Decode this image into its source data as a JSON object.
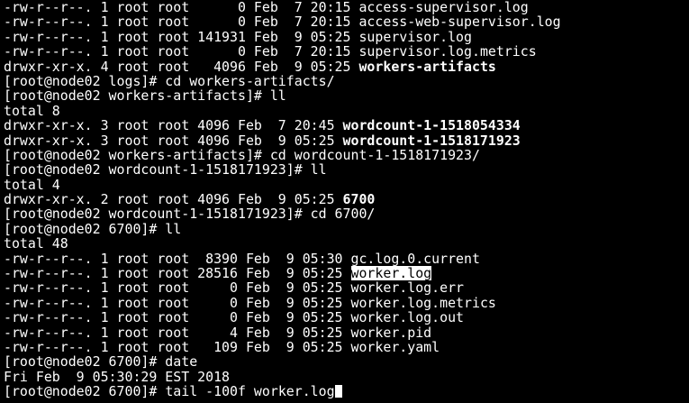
{
  "terminal": {
    "lines": [
      {
        "prefix": "-rw-r--r--. 1 root root      0 Feb  7 20:15 ",
        "name": "access-supervisor.log",
        "style": "normal"
      },
      {
        "prefix": "-rw-r--r--. 1 root root      0 Feb  7 20:15 ",
        "name": "access-web-supervisor.log",
        "style": "normal"
      },
      {
        "prefix": "-rw-r--r--. 1 root root 141931 Feb  9 05:25 ",
        "name": "supervisor.log",
        "style": "normal"
      },
      {
        "prefix": "-rw-r--r--. 1 root root      0 Feb  7 20:15 ",
        "name": "supervisor.log.metrics",
        "style": "normal"
      },
      {
        "prefix": "drwxr-xr-x. 4 root root   4096 Feb  9 05:25 ",
        "name": "workers-artifacts",
        "style": "bold"
      },
      {
        "prefix": "[root@node02 logs]# cd workers-artifacts/",
        "name": "",
        "style": "normal"
      },
      {
        "prefix": "[root@node02 workers-artifacts]# ll",
        "name": "",
        "style": "normal"
      },
      {
        "prefix": "total 8",
        "name": "",
        "style": "normal"
      },
      {
        "prefix": "drwxr-xr-x. 3 root root 4096 Feb  7 20:45 ",
        "name": "wordcount-1-1518054334",
        "style": "bold"
      },
      {
        "prefix": "drwxr-xr-x. 3 root root 4096 Feb  9 05:25 ",
        "name": "wordcount-1-1518171923",
        "style": "bold"
      },
      {
        "prefix": "[root@node02 workers-artifacts]# cd wordcount-1-1518171923/",
        "name": "",
        "style": "normal"
      },
      {
        "prefix": "[root@node02 wordcount-1-1518171923]# ll",
        "name": "",
        "style": "normal"
      },
      {
        "prefix": "total 4",
        "name": "",
        "style": "normal"
      },
      {
        "prefix": "drwxr-xr-x. 2 root root 4096 Feb  9 05:25 ",
        "name": "6700",
        "style": "bold"
      },
      {
        "prefix": "[root@node02 wordcount-1-1518171923]# cd 6700/",
        "name": "",
        "style": "normal"
      },
      {
        "prefix": "[root@node02 6700]# ll",
        "name": "",
        "style": "normal"
      },
      {
        "prefix": "total 48",
        "name": "",
        "style": "normal"
      },
      {
        "prefix": "-rw-r--r--. 1 root root  8390 Feb  9 05:30 ",
        "name": "gc.log.0.current",
        "style": "normal"
      },
      {
        "prefix": "-rw-r--r--. 1 root root 28516 Feb  9 05:25 ",
        "name": "worker.log",
        "style": "highlight"
      },
      {
        "prefix": "-rw-r--r--. 1 root root     0 Feb  9 05:25 ",
        "name": "worker.log.err",
        "style": "normal"
      },
      {
        "prefix": "-rw-r--r--. 1 root root     0 Feb  9 05:25 ",
        "name": "worker.log.metrics",
        "style": "normal"
      },
      {
        "prefix": "-rw-r--r--. 1 root root     0 Feb  9 05:25 ",
        "name": "worker.log.out",
        "style": "normal"
      },
      {
        "prefix": "-rw-r--r--. 1 root root     4 Feb  9 05:25 ",
        "name": "worker.pid",
        "style": "normal"
      },
      {
        "prefix": "-rw-r--r--. 1 root root   109 Feb  9 05:25 ",
        "name": "worker.yaml",
        "style": "normal"
      },
      {
        "prefix": "[root@node02 6700]# date",
        "name": "",
        "style": "normal"
      },
      {
        "prefix": "Fri Feb  9 05:30:29 EST 2018",
        "name": "",
        "style": "normal"
      }
    ],
    "prompt": "[root@node02 6700]# ",
    "command_input": "tail -100f worker.log",
    "colors": {
      "background": "#000000",
      "foreground": "#ffffff",
      "highlight_bg": "#ffffff",
      "highlight_fg": "#000000"
    }
  }
}
